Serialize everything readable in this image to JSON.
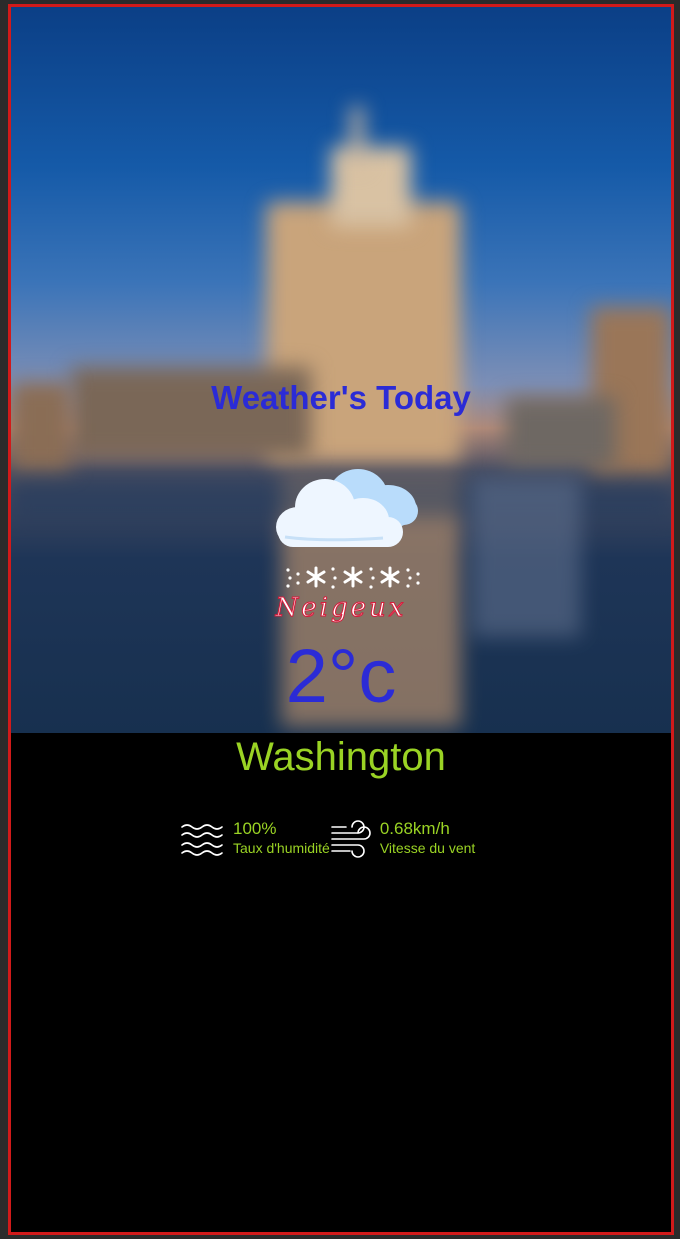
{
  "app": {
    "title": "Weather's Today"
  },
  "weather": {
    "condition": "Neigeux",
    "icon": "cloud-snow-icon",
    "temperature": "2°c",
    "city": "Washington"
  },
  "stats": {
    "humidity": {
      "value": "100%",
      "label": "Taux d'humidité",
      "icon": "humidity-waves-icon"
    },
    "wind": {
      "value": "0.68km/h",
      "label": "Vitesse du vent",
      "icon": "wind-icon"
    }
  },
  "colors": {
    "title": "#2b2bd6",
    "temperature": "#2b2bd6",
    "city": "#9ad324",
    "stats_text": "#9ad324",
    "frame_border": "#d11a1a",
    "condition_outline": "#d81b3b"
  }
}
